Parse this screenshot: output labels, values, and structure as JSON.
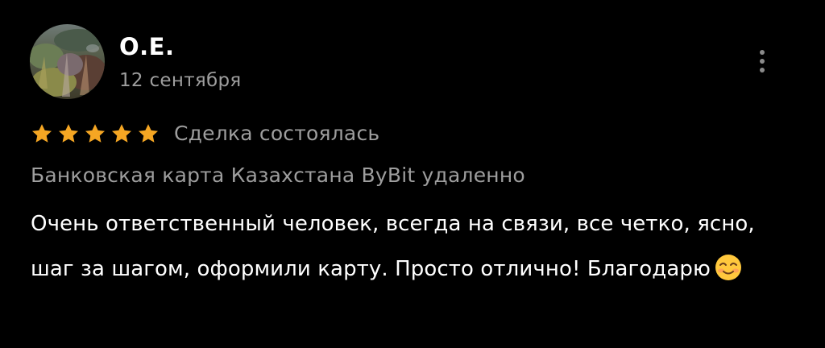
{
  "review": {
    "author_name": "О.Е.",
    "date": "12 сентября",
    "rating": 5,
    "rating_max": 5,
    "deal_status": "Сделка состоялась",
    "product_title": "Банковская карта Казахстана ByBit удаленно",
    "text": "Очень ответственный человек, всегда на связи, все четко, ясно, шаг за шагом, оформили карту. Просто отлично! Благодарю",
    "text_emoji": "smiling-face-emoji"
  },
  "icons": {
    "star": "star-icon",
    "more": "more-vertical-icon",
    "avatar": "avatar-photo"
  },
  "colors": {
    "background": "#000000",
    "star": "#f5a623",
    "primary_text": "#ffffff",
    "secondary_text": "#9e9e9e",
    "menu_dots": "#8a8a8a"
  }
}
